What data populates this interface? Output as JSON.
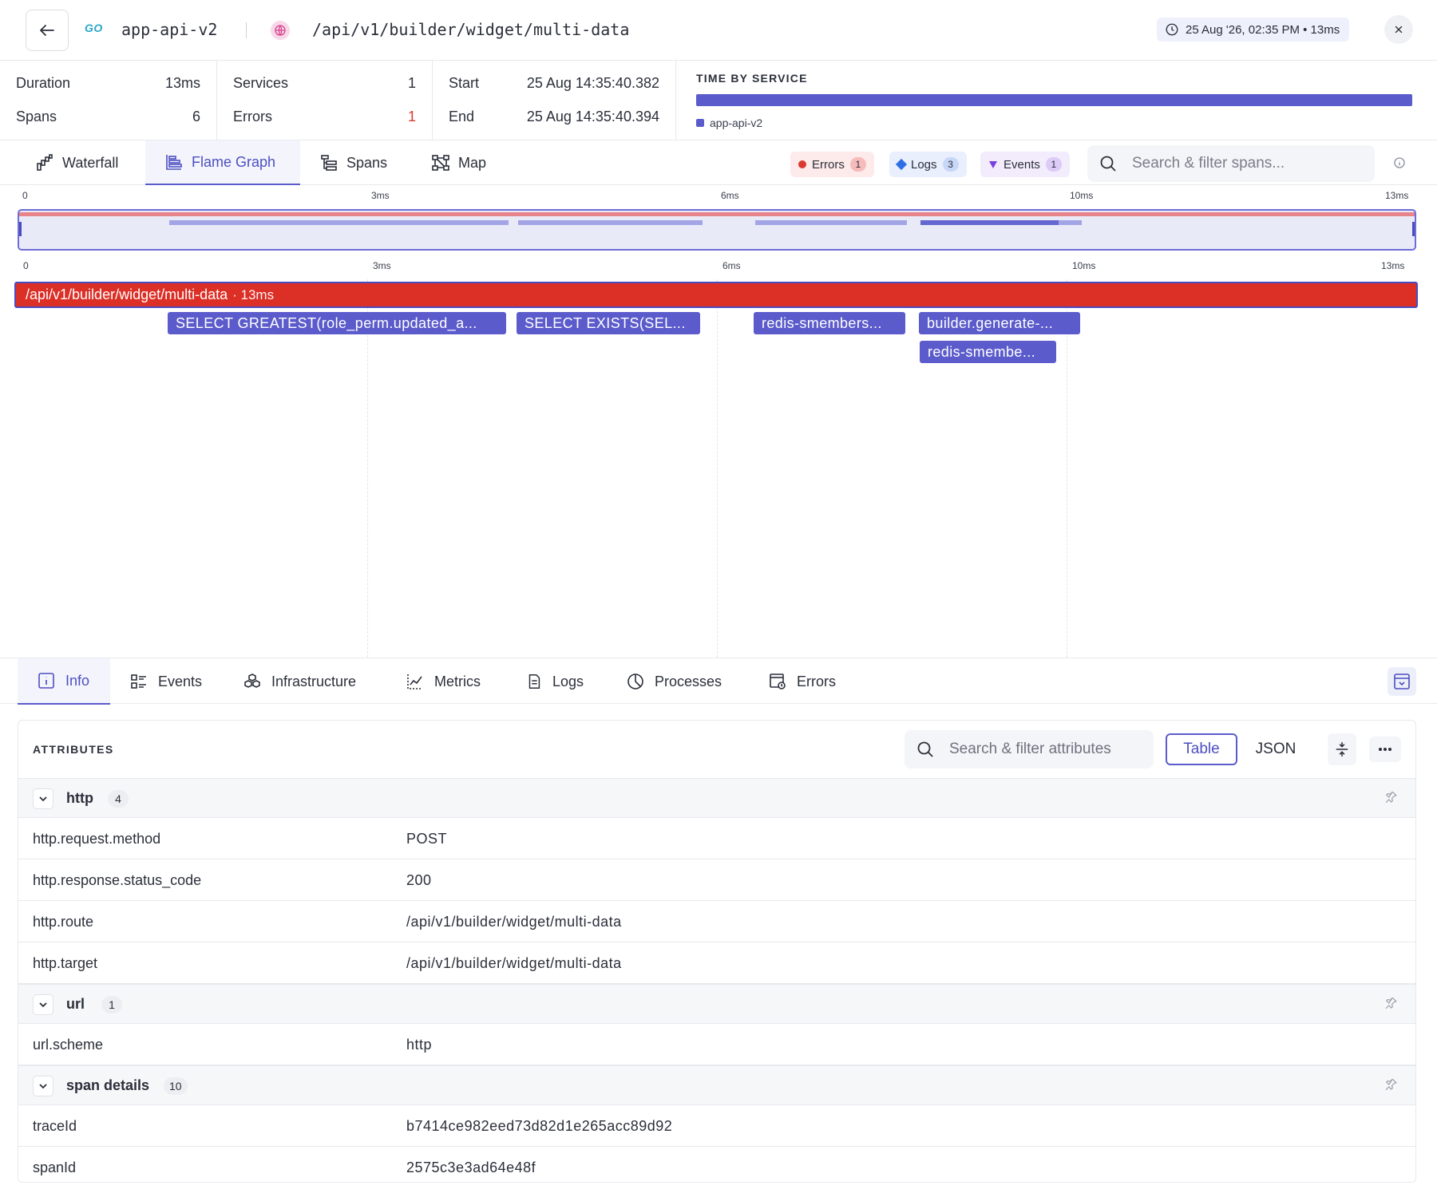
{
  "header": {
    "service_logo": "GO",
    "service_name": "app-api-v2",
    "route": "/api/v1/builder/widget/multi-data",
    "time_badge": "25 Aug '26, 02:35 PM • 13ms"
  },
  "stats": {
    "duration_label": "Duration",
    "duration_value": "13ms",
    "spans_label": "Spans",
    "spans_value": "6",
    "services_label": "Services",
    "services_value": "1",
    "errors_label": "Errors",
    "errors_value": "1",
    "start_label": "Start",
    "start_value": "25 Aug 14:35:40.382",
    "end_label": "End",
    "end_value": "25 Aug 14:35:40.394",
    "time_by_service_title": "TIME BY SERVICE",
    "time_by_service_legend": "app-api-v2",
    "service_color": "#5b5bcc"
  },
  "main_tabs": {
    "waterfall": "Waterfall",
    "flame_graph": "Flame Graph",
    "spans": "Spans",
    "map": "Map",
    "active": "Flame Graph"
  },
  "chips": {
    "errors_label": "Errors",
    "errors_count": "1",
    "logs_label": "Logs",
    "logs_count": "3",
    "events_label": "Events",
    "events_count": "1"
  },
  "span_search": {
    "placeholder": "Search & filter spans..."
  },
  "ruler": {
    "t0": "0",
    "t1": "3ms",
    "t2": "6ms",
    "t3": "10ms",
    "t4": "13ms"
  },
  "flame": {
    "root": {
      "label": "/api/v1/builder/widget/multi-data",
      "duration": "· 13ms",
      "color": "#dc2f26"
    },
    "child_color": "#5b5bcc",
    "spans": [
      {
        "label": "SELECT GREATEST(role_perm.updated_a..."
      },
      {
        "label": "SELECT EXISTS(SEL..."
      },
      {
        "label": "redis-smembers..."
      },
      {
        "label": "builder.generate-..."
      },
      {
        "label": "redis-smembe..."
      }
    ]
  },
  "detail_tabs": {
    "info": "Info",
    "events": "Events",
    "infrastructure": "Infrastructure",
    "metrics": "Metrics",
    "logs": "Logs",
    "processes": "Processes",
    "errors": "Errors",
    "active": "Info"
  },
  "attributes": {
    "title": "ATTRIBUTES",
    "search_placeholder": "Search & filter attributes",
    "view_table": "Table",
    "view_json": "JSON",
    "groups": [
      {
        "name": "http",
        "count": "4",
        "rows": [
          {
            "key": "http.request.method",
            "value": "POST"
          },
          {
            "key": "http.response.status_code",
            "value": "200"
          },
          {
            "key": "http.route",
            "value": "/api/v1/builder/widget/multi-data"
          },
          {
            "key": "http.target",
            "value": "/api/v1/builder/widget/multi-data"
          }
        ]
      },
      {
        "name": "url",
        "count": "1",
        "rows": [
          {
            "key": "url.scheme",
            "value": "http"
          }
        ]
      },
      {
        "name": "span details",
        "count": "10",
        "rows": [
          {
            "key": "traceId",
            "value": "b7414ce982eed73d82d1e265acc89d92"
          },
          {
            "key": "spanId",
            "value": "2575c3e3ad64e48f"
          }
        ]
      }
    ]
  }
}
